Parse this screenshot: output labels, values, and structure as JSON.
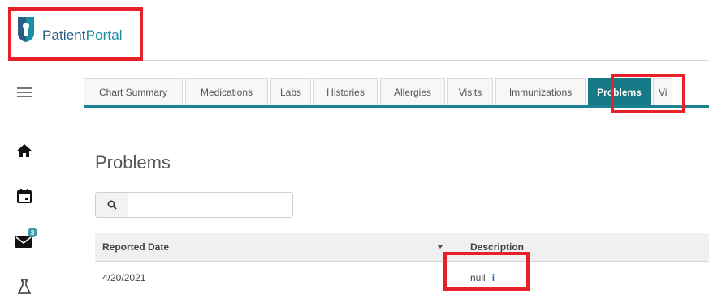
{
  "app": {
    "logo_part1": "Patient",
    "logo_part2": "Portal",
    "brand_color": "#1a8ea2",
    "highlight_color": "#e8202a"
  },
  "sidebar": {
    "items": [
      {
        "icon": "hamburger-menu-icon"
      },
      {
        "icon": "home-icon"
      },
      {
        "icon": "calendar-icon"
      },
      {
        "icon": "mail-icon",
        "badge": "3"
      },
      {
        "icon": "lab-flask-icon"
      }
    ]
  },
  "tabs": [
    {
      "label": "Chart Summary",
      "active": false
    },
    {
      "label": "Medications",
      "active": false
    },
    {
      "label": "Labs",
      "active": false
    },
    {
      "label": "Histories",
      "active": false
    },
    {
      "label": "Allergies",
      "active": false
    },
    {
      "label": "Visits",
      "active": false
    },
    {
      "label": "Immunizations",
      "active": false
    },
    {
      "label": "Problems",
      "active": true
    },
    {
      "label": "Vi",
      "active": false
    }
  ],
  "main": {
    "title": "Problems",
    "search": {
      "value": "",
      "placeholder": ""
    },
    "table": {
      "columns": [
        "Reported Date",
        "Description"
      ],
      "rows": [
        {
          "reported_date": "4/20/2021",
          "description": "null",
          "info": "i"
        }
      ]
    }
  }
}
